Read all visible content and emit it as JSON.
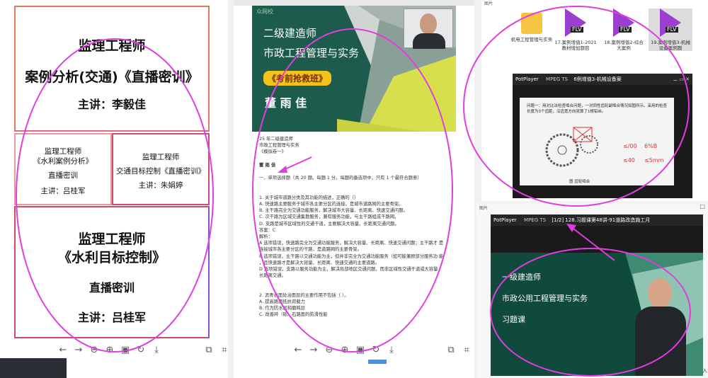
{
  "left": {
    "card_top": {
      "line1": "监理工程师",
      "line2": "案例分析(交通)《直播密训》",
      "line3": "主讲：李毅佳"
    },
    "card_mid_left": {
      "line1": "监理工程师",
      "line2": "《水利案例分析》",
      "line3": "直播密训",
      "line4": "主讲：吕桂军"
    },
    "card_mid_right": {
      "line1": "监理工程师",
      "line2": "交通目标控制《直播密训》",
      "line3": "主讲：朱娟婷"
    },
    "card_bottom": {
      "line1": "监理工程师",
      "line2": "《水利目标控制》",
      "line3": "直播密训",
      "line4": "主讲：吕桂军"
    }
  },
  "middle": {
    "header": "众网校",
    "slide": {
      "title1": "二级建造师",
      "title2": "市政工程管理与实务",
      "badge": "《考前抢救班》",
      "teacher": "董 雨 佳"
    },
    "doc_lines": [
      "25 年二级建造师",
      "市政工程管理与实务",
      "《模拟卷一》",
      "",
      "董 雨 佳",
      "",
      "一、单项选择题（共 20 题。每题 1 分。每题的备选项中，只有 1 个最符合题意）",
      "",
      "",
      "1. 关于城市道路分类及其功能的描述，正确的（）",
      "A. 快速路主要服务于城市各主要分区的连接，是城市道路网的主要骨架。",
      "B. 主干路完全为交通功能服务，解决城市大容量、长距离、快速交通问题。",
      "C. 次干路为区域交通集散服务，兼有服务功能，与主干路组成干路网。",
      "D. 支路是城市区域性的交通干道，主要解决大容量、长距离交通问题。",
      "答案：C",
      "解析：",
      "A 选项错误，快速路完全为交通功能服务，解决大容量、长距离、快速交通问题；主干路才 是",
      "连接城市各主要分区的干路，是道路网的主要骨架。",
      "B 选项错误，主干路以交通功能为主，但并非完全为交通功能服务（如可能兼顾部分服务功 能",
      "，且快速路才是解决大容量、长距离、快速交通的主要道路。",
      "D 选项错误，支路以服务功能为主，解决局部地区交通问题，而非区域性交通干道或大容量，",
      "长距离交通。",
      "",
      "",
      "2. 沥青表面处治面层的主要作用不包括（ ）。",
      "A. 提高路面抵抗荷载力",
      "B. 作为防水层和磨耗层",
      "C. 改善碎（砾）石路面的防滑性能"
    ]
  },
  "right_top": {
    "corner_label": "图片",
    "files": [
      {
        "name": "机电工程管理与实务",
        "type": "folder"
      },
      {
        "name": "17.案例增值1-2021教材增加题目",
        "type": "FLV"
      },
      {
        "name": "18.案例增值2-综合大案例",
        "type": "FLV"
      },
      {
        "name": "19.案例增值3-机械设备案例题",
        "type": "FLV"
      }
    ],
    "player": {
      "app": "PotPlayer",
      "format": "MPEG TS",
      "title": "6例增值3-机械设备案",
      "question": "问题一：用对比法检查啮合问题，一对同性齿轮副啮合情况如图所示。采用的检查长度为3个齿距，沿齿宽方向就算了1根铅丝。",
      "caption": "图 齿轮啮合",
      "notes": [
        "≤/00",
        "6%B",
        "≤40",
        "≤5mm"
      ]
    }
  },
  "right_bottom": {
    "corner_label": "图片",
    "player": {
      "app": "PotPlayer",
      "format": "MPEG TS",
      "title": "[1/2] 128.习题课第48讲-91道路改造施工月",
      "lines": [
        "一级建造师",
        "市政公用工程管理与实务",
        "习题课"
      ],
      "tail": "入"
    }
  },
  "colors": {
    "annotation": "#e03de0",
    "slide_green": "#1d5c4c",
    "badge": "#f2c318",
    "flv_purple": "#9b3fd1"
  }
}
